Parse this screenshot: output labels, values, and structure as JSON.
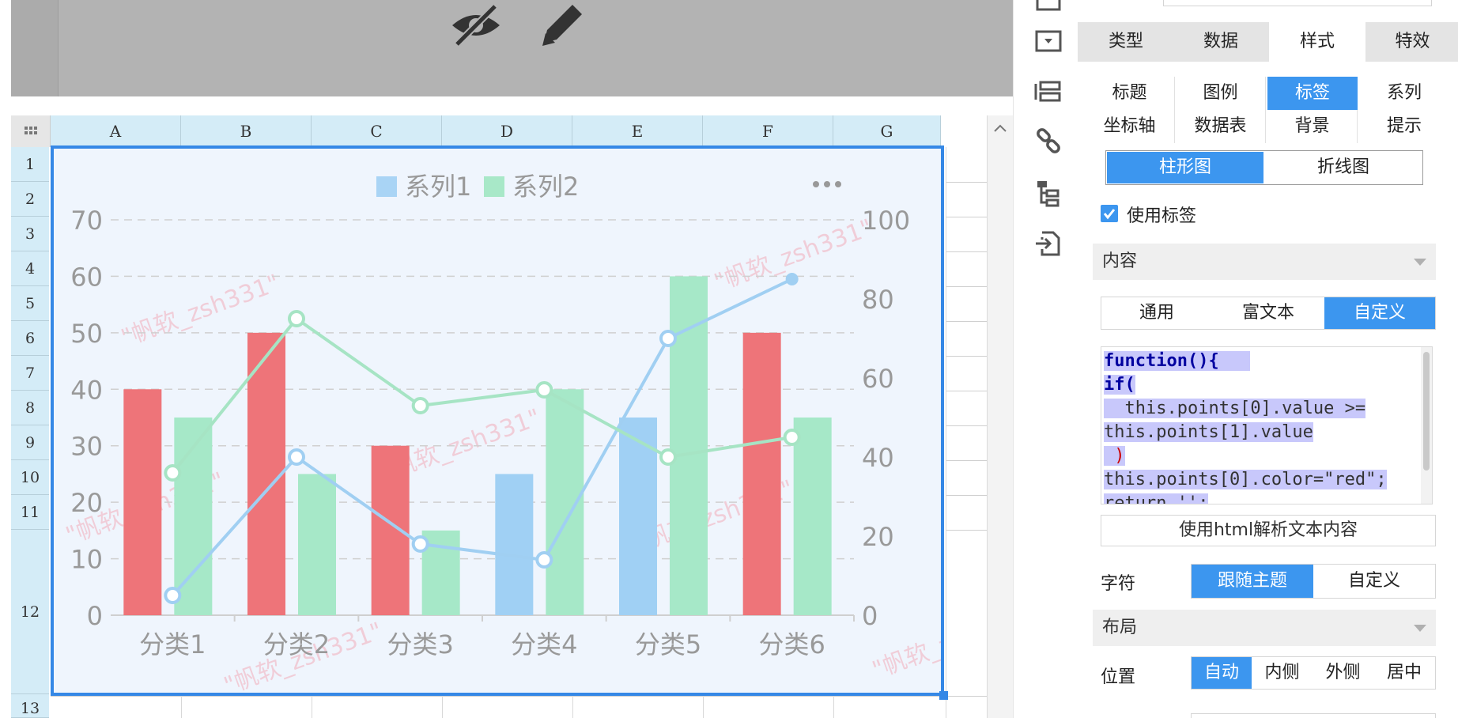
{
  "sheet": {
    "columns": [
      "A",
      "B",
      "C",
      "D",
      "E",
      "F",
      "G"
    ],
    "rows": [
      "1",
      "2",
      "3",
      "4",
      "5",
      "6",
      "7",
      "8",
      "9",
      "10",
      "11",
      "12",
      "13"
    ]
  },
  "panel": {
    "main_tabs": [
      "类型",
      "数据",
      "样式",
      "特效"
    ],
    "active_main_tab": "样式",
    "sub_tabs_row1": [
      "标题",
      "图例",
      "标签",
      "系列"
    ],
    "sub_tabs_row2": [
      "坐标轴",
      "数据表",
      "背景",
      "提示"
    ],
    "active_sub_tab": "标签",
    "chart_kind_tabs": [
      "柱形图",
      "折线图"
    ],
    "use_label_text": "使用标签",
    "use_label_checked": true,
    "content_section": "内容",
    "content_modes": [
      "通用",
      "富文本",
      "自定义"
    ],
    "code_lines": [
      "function(){",
      "if(",
      "  this.points[0].value >=",
      "this.points[1].value",
      " )",
      "this.points[0].color=\"red\";",
      "return '';"
    ],
    "html_parse_button": "使用html解析文本内容",
    "font_label": "字符",
    "font_modes": [
      "跟随主题",
      "自定义"
    ],
    "layout_section": "布局",
    "position_label": "位置",
    "position_modes": [
      "自动",
      "内侧",
      "外侧",
      "居中"
    ]
  },
  "chart_data": {
    "type": "bar",
    "categories": [
      "分类1",
      "分类2",
      "分类3",
      "分类4",
      "分类5",
      "分类6"
    ],
    "legend": [
      "系列1",
      "系列2"
    ],
    "legend_position": "top",
    "series": [
      {
        "name": "系列1",
        "type": "bar",
        "axis": "left",
        "values": [
          40,
          50,
          30,
          25,
          35,
          50
        ]
      },
      {
        "name": "系列2",
        "type": "bar",
        "axis": "left",
        "values": [
          35,
          25,
          15,
          40,
          60,
          35
        ]
      },
      {
        "name": "系列1",
        "type": "line",
        "axis": "right",
        "values": [
          5,
          40,
          18,
          14,
          70,
          85
        ]
      },
      {
        "name": "系列2",
        "type": "line",
        "axis": "right",
        "values": [
          36,
          75,
          53,
          57,
          40,
          45
        ]
      }
    ],
    "highlight_rule": "series1 bar red when value >= series2 value",
    "left_axis": {
      "min": 0,
      "max": 70,
      "ticks": [
        0,
        10,
        20,
        30,
        40,
        50,
        60,
        70
      ]
    },
    "right_axis": {
      "min": 0,
      "max": 100,
      "ticks": [
        0,
        20,
        40,
        60,
        80,
        100
      ]
    },
    "grid": "horizontal dashed",
    "colors": {
      "bar_red": "#ee7479",
      "bar_blue": "#a0d0f4",
      "bar_green": "#a6e8c8",
      "line_blue": "#a0cff2",
      "line_green": "#a6e4c4"
    },
    "watermark": "\"帆软_zsh331\""
  }
}
